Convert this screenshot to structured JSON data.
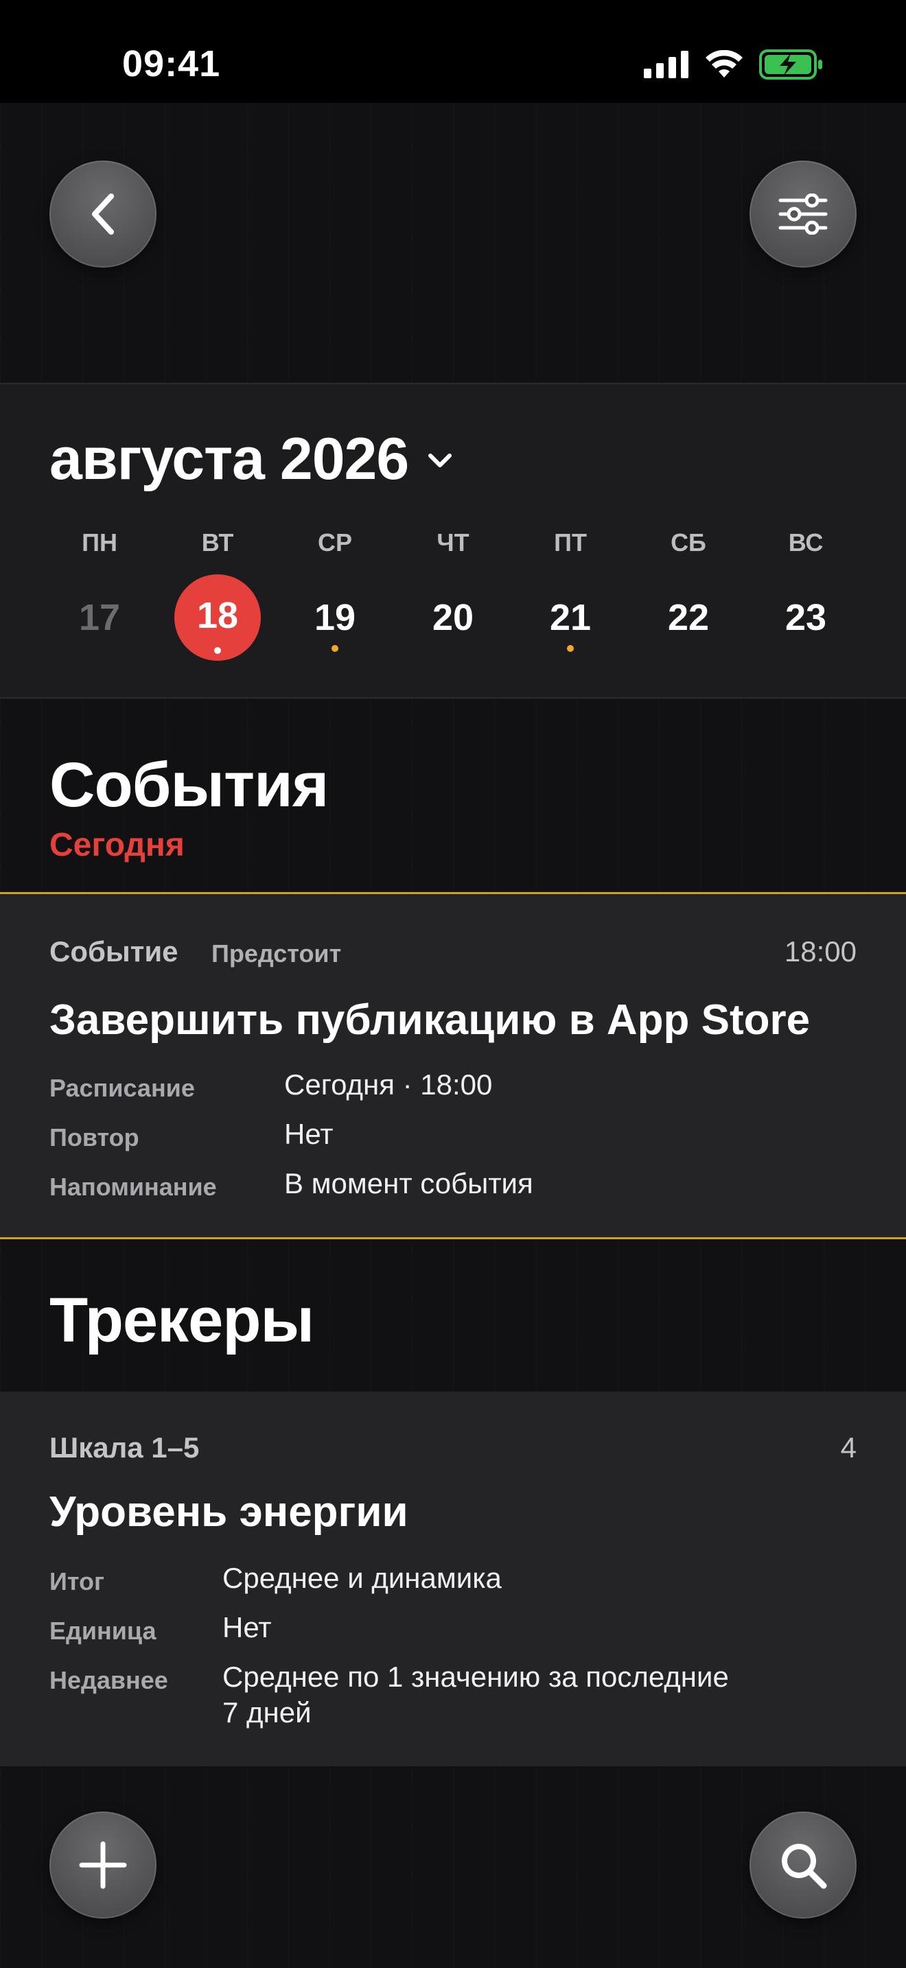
{
  "status": {
    "time": "09:41"
  },
  "icons": {
    "back": "chevron-left-icon",
    "filter": "sliders-icon",
    "add": "plus-icon",
    "search": "search-icon"
  },
  "calendar": {
    "month": "августа 2026",
    "weekdays": [
      "ПН",
      "ВТ",
      "СР",
      "ЧТ",
      "ПТ",
      "СБ",
      "ВС"
    ],
    "days": [
      "17",
      "18",
      "19",
      "20",
      "21",
      "22",
      "23"
    ]
  },
  "events": {
    "title": "События",
    "subtitle": "Сегодня",
    "item": {
      "kind": "Событие",
      "state": "Предстоит",
      "time": "18:00",
      "title": "Завершить публикацию в App Store",
      "rows": [
        {
          "label": "Расписание",
          "value": "Сегодня · 18:00"
        },
        {
          "label": "Повтор",
          "value": "Нет"
        },
        {
          "label": "Напоминание",
          "value": "В момент события"
        }
      ]
    }
  },
  "trackers": {
    "title": "Трекеры",
    "item": {
      "kind": "Шкала 1–5",
      "value": "4",
      "title": "Уровень энергии",
      "rows": [
        {
          "label": "Итог",
          "value": "Среднее и динамика"
        },
        {
          "label": "Единица",
          "value": "Нет"
        },
        {
          "label": "Недавнее",
          "value_line1": "Среднее по 1 значению за последние",
          "value_line2": "7 дней"
        }
      ]
    }
  },
  "colors": {
    "accent_red": "#e5403b",
    "accent_gold": "#c9a227",
    "event_dot": "#f0a92c"
  }
}
